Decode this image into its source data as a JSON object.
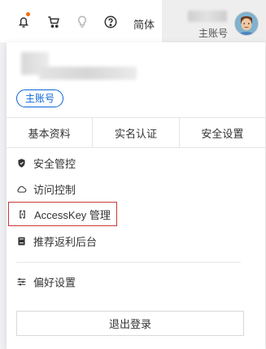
{
  "topbar": {
    "language_label": "简体",
    "account_role": "主账号",
    "icons": [
      "bell-icon",
      "cart-icon",
      "bulb-icon",
      "help-icon"
    ],
    "notification_dot_color": "#ff6a00"
  },
  "dropdown": {
    "badge": "主账号",
    "tabs": [
      "基本资料",
      "实名认证",
      "安全设置"
    ],
    "menu": [
      {
        "label": "安全管控",
        "icon": "shield-icon"
      },
      {
        "label": "访问控制",
        "icon": "cloud-icon"
      },
      {
        "label": "AccessKey 管理",
        "icon": "key-icon"
      },
      {
        "label": "推荐返利后台",
        "icon": "book-icon"
      },
      {
        "label": "偏好设置",
        "icon": "sliders-icon"
      }
    ],
    "logout": "退出登录"
  },
  "colors": {
    "accent": "#0a66d8",
    "highlight_border": "#c83a3a"
  }
}
